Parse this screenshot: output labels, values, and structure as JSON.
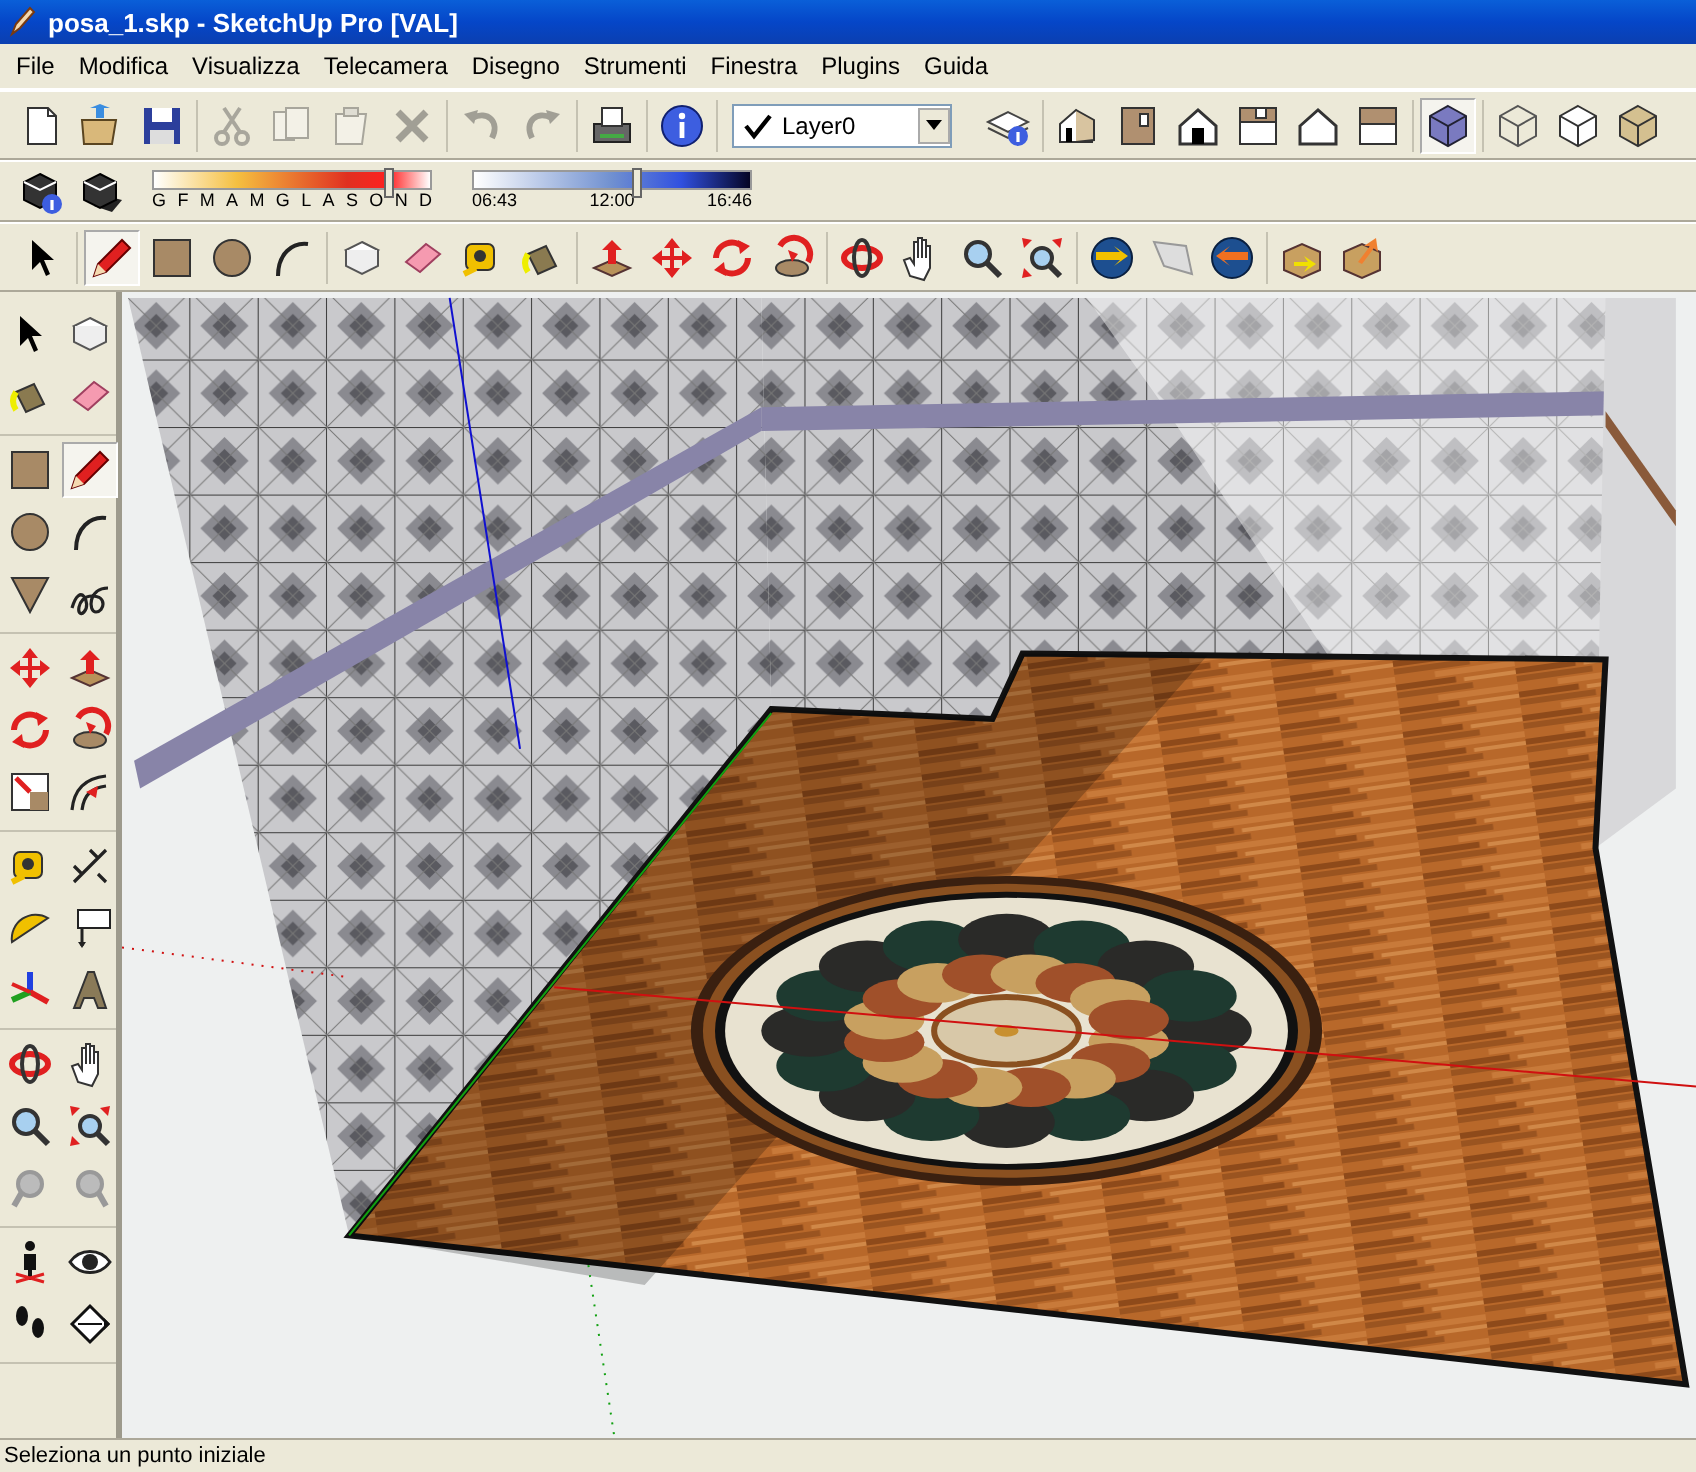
{
  "window": {
    "title": "posa_1.skp - SketchUp Pro [VAL]"
  },
  "menu": [
    "File",
    "Modifica",
    "Visualizza",
    "Telecamera",
    "Disegno",
    "Strumenti",
    "Finestra",
    "Plugins",
    "Guida"
  ],
  "standard_toolbar": {
    "groups": [
      [
        {
          "disabled": false
        },
        {
          "disabled": false
        },
        {
          "disabled": false
        }
      ],
      [
        {
          "disabled": true
        },
        {
          "disabled": true
        },
        {
          "disabled": true
        },
        {
          "disabled": true
        }
      ],
      [
        {
          "disabled": true
        },
        {
          "disabled": true
        }
      ],
      [
        {
          "disabled": false
        }
      ],
      [
        {
          "disabled": false
        }
      ]
    ]
  },
  "layer_dropdown": {
    "value": "Layer0",
    "checked": true
  },
  "views_toolbar": {
    "groups": [
      [
        {
          "disabled": false
        }
      ],
      [
        {
          "disabled": false
        },
        {
          "disabled": false
        },
        {
          "disabled": false
        },
        {
          "disabled": false
        },
        {
          "disabled": false
        },
        {
          "disabled": false
        }
      ],
      [
        {
          "selected": true
        }
      ],
      [
        {
          "selected": false
        },
        {
          "selected": false
        },
        {
          "selected": false
        }
      ]
    ]
  },
  "shadow_toolbar": {
    "date_slider": {
      "level": 0.85,
      "labels": [
        "G",
        "F",
        "M",
        "A",
        "M",
        "G",
        "L",
        "A",
        "S",
        "O",
        "N",
        "D"
      ]
    },
    "time_slider": {
      "level": 0.59,
      "labels": [
        "06:43",
        "12:00",
        "16:46"
      ]
    }
  },
  "main_toolbar": {
    "groups": [
      [
        {
          "selected": false
        }
      ],
      [
        {
          "selected": true
        },
        {
          "selected": false
        },
        {
          "selected": false
        },
        {
          "selected": false
        }
      ],
      [
        {
          "selected": false
        },
        {
          "selected": false
        },
        {
          "selected": false
        },
        {
          "selected": false
        }
      ],
      [
        {
          "selected": false
        },
        {
          "selected": false
        },
        {
          "selected": false
        },
        {
          "selected": false
        }
      ],
      [
        {
          "selected": false
        },
        {
          "selected": false
        },
        {
          "selected": false
        },
        {
          "selected": false
        }
      ],
      [
        {
          "selected": false
        },
        {
          "selected": false
        },
        {
          "selected": false
        }
      ],
      [
        {
          "selected": false
        },
        {
          "selected": false
        }
      ]
    ]
  },
  "left_toolbar": {
    "groups": [
      [
        {
          "selected": false
        },
        {
          "selected": false
        },
        {
          "selected": false
        },
        {
          "selected": false
        }
      ],
      [
        {
          "selected": false
        },
        {
          "selected": true
        },
        {
          "selected": false
        },
        {
          "selected": false
        },
        {
          "selected": false
        },
        {
          "selected": false
        }
      ],
      [
        {
          "selected": false
        },
        {
          "selected": false
        },
        {
          "selected": false
        },
        {
          "selected": false
        },
        {
          "selected": false
        },
        {
          "selected": false
        }
      ],
      [
        {
          "selected": false
        },
        {
          "selected": false
        },
        {
          "selected": false
        },
        {
          "selected": false
        },
        {
          "selected": false
        },
        {
          "selected": false
        }
      ],
      [
        {
          "selected": false
        },
        {
          "selected": false
        },
        {
          "selected": false
        },
        {
          "selected": false
        },
        {
          "selected": false
        },
        {
          "selected": false
        }
      ],
      [
        {
          "selected": false
        },
        {
          "selected": false
        },
        {
          "selected": false
        },
        {
          "selected": false
        }
      ]
    ]
  },
  "status_bar": {
    "text": "Seleziona un punto iniziale"
  }
}
